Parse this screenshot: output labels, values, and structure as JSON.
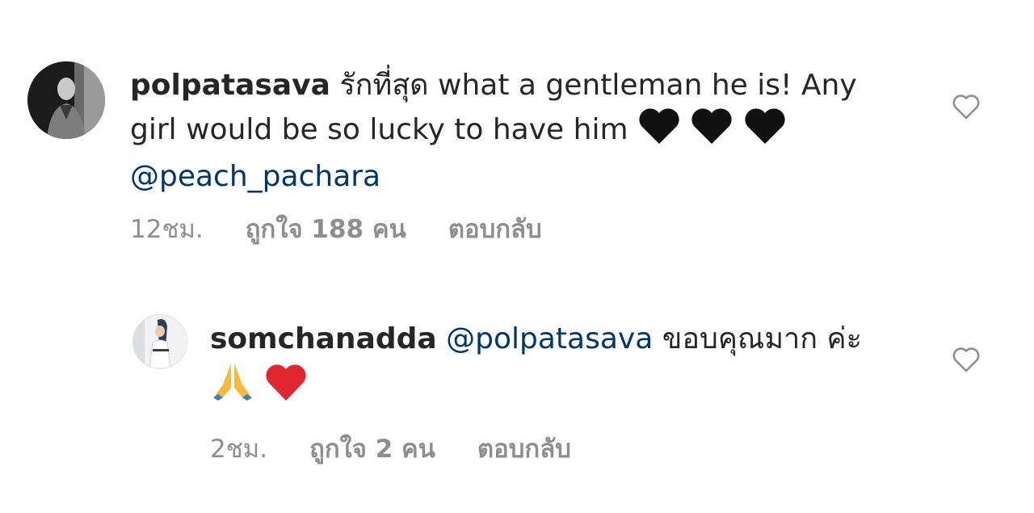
{
  "comments": [
    {
      "username": "polpatasava",
      "text_before_mention": "รักที่สุด what a gentleman he is! Any girl would be so lucky to have him",
      "emojis_before_mention": [
        "black-heart",
        "black-heart",
        "black-heart"
      ],
      "mention": "@peach_pachara",
      "text_after_mention": "",
      "time": "12ชม.",
      "likes": "ถูกใจ 188 คน",
      "reply": "ตอบกลับ"
    },
    {
      "username": "somchanadda",
      "text_before_mention": "",
      "mention": "@polpatasava",
      "text_after_mention": "ขอบคุณมาก ค่ะ",
      "emojis_after_text": [
        "folded-hands",
        "red-heart"
      ],
      "time": "2ชม.",
      "likes": "ถูกใจ 2 คน",
      "reply": "ตอบกลับ"
    }
  ],
  "colors": {
    "text": "#262626",
    "secondary": "#8e8e8e",
    "mention": "#00376b",
    "heart_outline": "#8e8e8e",
    "red_heart": "#e0262f",
    "black_heart": "#111111"
  },
  "icons": {
    "like": "heart-outline-icon"
  }
}
